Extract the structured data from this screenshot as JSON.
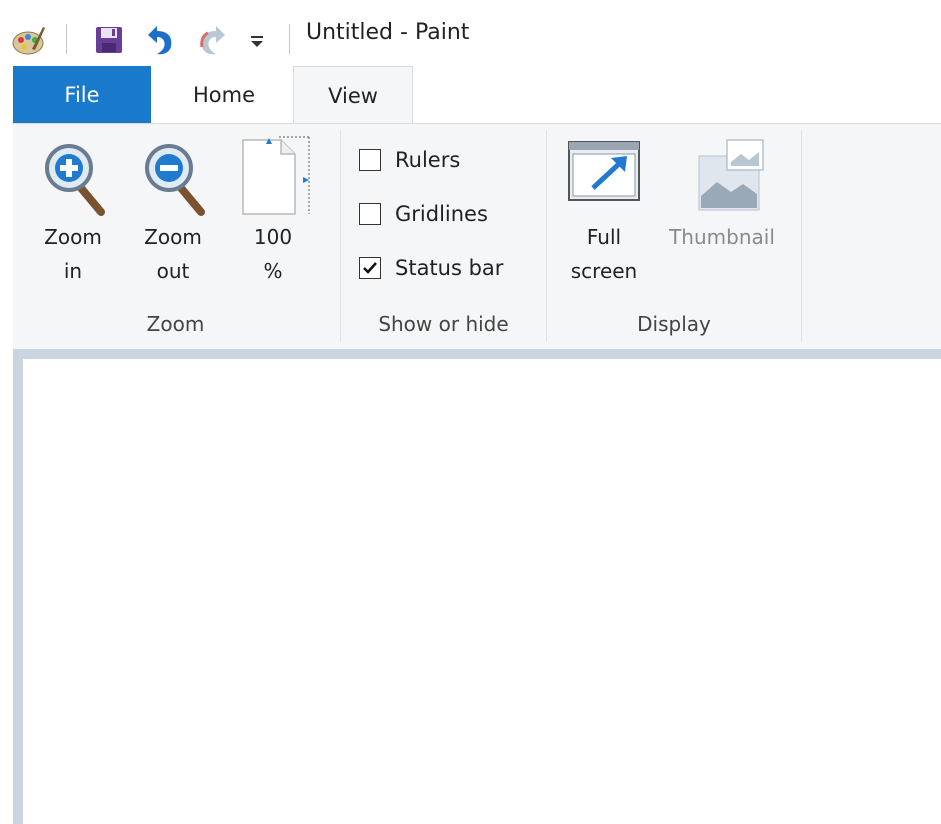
{
  "window": {
    "title": "Untitled - Paint"
  },
  "quick_access": {
    "items": [
      {
        "icon": "paint-app-icon"
      },
      {
        "icon": "save-icon"
      },
      {
        "icon": "undo-icon"
      },
      {
        "icon": "redo-icon"
      },
      {
        "icon": "customize-dropdown-icon"
      }
    ]
  },
  "tabs": [
    {
      "label": "File",
      "selected": false
    },
    {
      "label": "Home",
      "selected": false
    },
    {
      "label": "View",
      "selected": true
    }
  ],
  "ribbon": {
    "zoom": {
      "label": "Zoom",
      "zoom_in": {
        "line1": "Zoom",
        "line2": "in",
        "icon": "zoom-in-icon"
      },
      "zoom_out": {
        "line1": "Zoom",
        "line2": "out",
        "icon": "zoom-out-icon"
      },
      "zoom_100": {
        "line1": "100",
        "line2": "%",
        "icon": "page-100-icon"
      }
    },
    "show_hide": {
      "label": "Show or hide",
      "rulers": {
        "label": "Rulers",
        "checked": false
      },
      "gridlines": {
        "label": "Gridlines",
        "checked": false
      },
      "status_bar": {
        "label": "Status bar",
        "checked": true
      }
    },
    "display": {
      "label": "Display",
      "full_screen": {
        "line1": "Full",
        "line2": "screen",
        "icon": "full-screen-icon"
      },
      "thumbnail": {
        "label": "Thumbnail",
        "icon": "thumbnail-icon",
        "enabled": false
      }
    }
  },
  "colors": {
    "file_tab": "#1979ca",
    "ribbon_bg": "#f5f6f7",
    "workspace": "#cbd5e1",
    "canvas": "#ffffff"
  }
}
